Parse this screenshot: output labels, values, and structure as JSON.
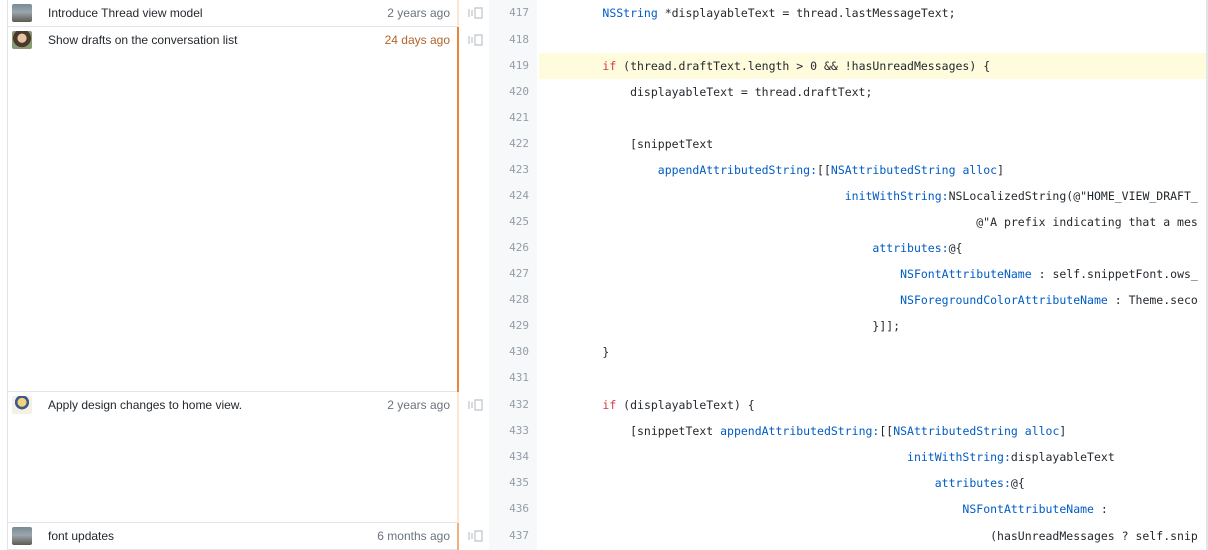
{
  "commits": [
    {
      "message": "Introduce Thread view model",
      "age": "2 years ago",
      "avatar": "photo-avatar"
    },
    {
      "message": "Show drafts on the conversation list",
      "age": "24 days ago",
      "avatar": "person-avatar"
    },
    {
      "message": "Apply design changes to home view.",
      "age": "2 years ago",
      "avatar": "cartoon-avatar"
    },
    {
      "message": "font updates",
      "age": "6 months ago",
      "avatar": "photo-avatar"
    }
  ],
  "lines": [
    {
      "n": "417",
      "code": "        NSString *displayableText = thread.lastMessageText;"
    },
    {
      "n": "418",
      "code": ""
    },
    {
      "n": "419",
      "code": "        if (thread.draftText.length > 0 && !hasUnreadMessages) {"
    },
    {
      "n": "420",
      "code": "            displayableText = thread.draftText;"
    },
    {
      "n": "421",
      "code": ""
    },
    {
      "n": "422",
      "code": "            [snippetText"
    },
    {
      "n": "423",
      "code": "                appendAttributedString:[[NSAttributedString alloc]"
    },
    {
      "n": "424",
      "code": "                                           initWithString:NSLocalizedString(@\"HOME_VIEW_DRAFT_"
    },
    {
      "n": "425",
      "code": "                                                              @\"A prefix indicating that a mes"
    },
    {
      "n": "426",
      "code": "                                               attributes:@{"
    },
    {
      "n": "427",
      "code": "                                                   NSFontAttributeName : self.snippetFont.ows_"
    },
    {
      "n": "428",
      "code": "                                                   NSForegroundColorAttributeName : Theme.seco"
    },
    {
      "n": "429",
      "code": "                                               }]];"
    },
    {
      "n": "430",
      "code": "        }"
    },
    {
      "n": "431",
      "code": ""
    },
    {
      "n": "432",
      "code": "        if (displayableText) {"
    },
    {
      "n": "433",
      "code": "            [snippetText appendAttributedString:[[NSAttributedString alloc]"
    },
    {
      "n": "434",
      "code": "                                                    initWithString:displayableText"
    },
    {
      "n": "435",
      "code": "                                                        attributes:@{"
    },
    {
      "n": "436",
      "code": "                                                            NSFontAttributeName :"
    },
    {
      "n": "437",
      "code": "                                                                (hasUnreadMessages ? self.snip"
    }
  ]
}
